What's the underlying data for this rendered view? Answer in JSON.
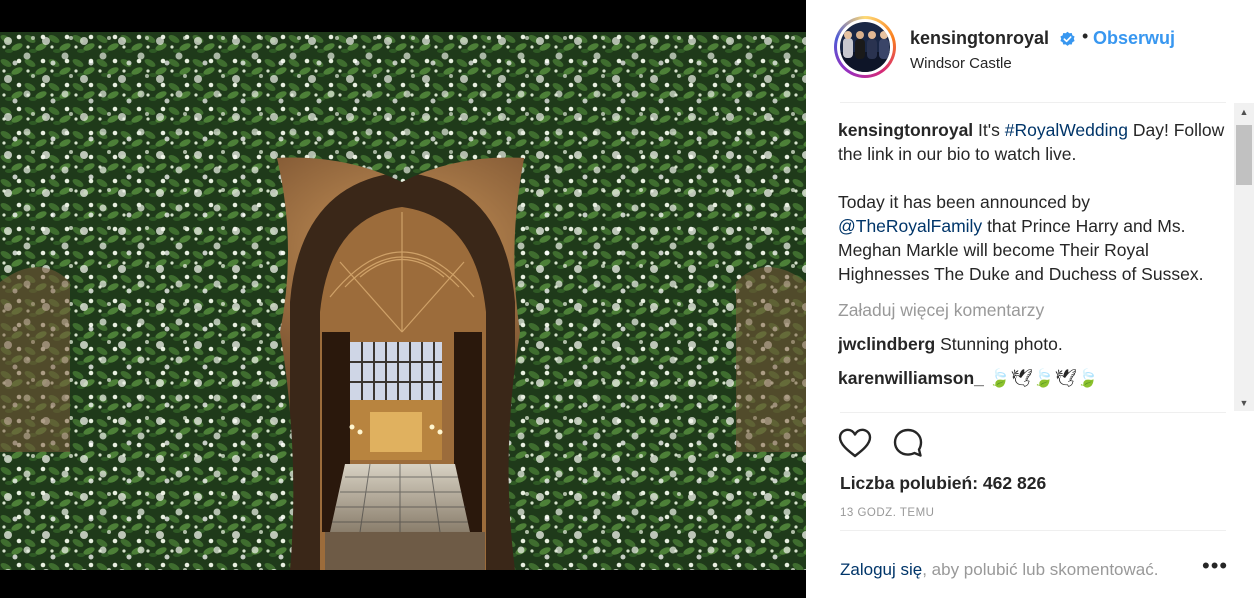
{
  "post": {
    "username": "kensingtonroyal",
    "dot": "•",
    "follow_label": "Obserwuj",
    "location": "Windsor Castle",
    "caption": {
      "username": "kensingtonroyal",
      "text_1": "It's",
      "hashtag": "#RoyalWedding",
      "text_2": "Day! Follow the link in our bio to watch live.",
      "text_3": "Today it has been announced by",
      "mention": "@TheRoyalFamily",
      "text_4": "that Prince Harry and Ms. Meghan Markle will become Their Royal Highnesses The Duke and Duchess of Sussex."
    },
    "load_more": "Załaduj więcej komentarzy",
    "comments": [
      {
        "user": "jwclindberg",
        "text": "Stunning photo."
      },
      {
        "user": "karenwilliamson_",
        "text": "🍃🕊🍃🕊🍃"
      }
    ],
    "likes_label": "Liczba polubień: 462 826",
    "time_ago": "13 GODZ. TEMU",
    "login_link": "Zaloguj się",
    "login_rest": ", aby polubić lub skomentować.",
    "more_label": "•••"
  },
  "icons": {
    "verified": "verified-badge-icon",
    "like": "heart-outline-icon",
    "comment": "speech-bubble-icon",
    "more": "ellipsis-icon"
  },
  "colors": {
    "accent": "#3897f0",
    "link": "#003569",
    "muted": "#999999",
    "text": "#262626"
  }
}
